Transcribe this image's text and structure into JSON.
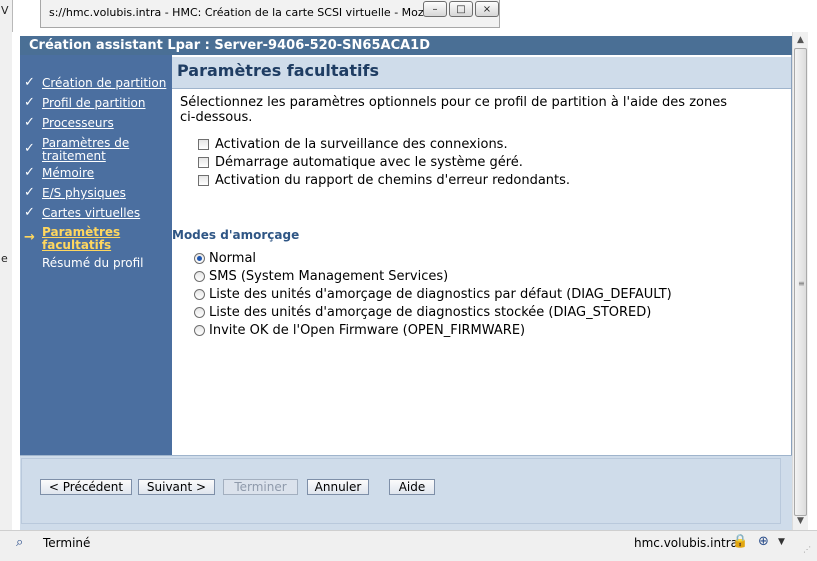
{
  "background_window": {
    "title": "s://hmc.volubis.intra - HMC: Création de la carte SCSI virtuelle - Moz...",
    "controls": [
      "–",
      "□",
      "×"
    ],
    "edge_letters": [
      "V",
      "e"
    ]
  },
  "dialog": {
    "title": "Création assistant Lpar : Server-9406-520-SN65ACA1D",
    "check_glyph": "✓",
    "arrow_glyph": "→",
    "nav": [
      {
        "label": "Création de partition",
        "state": "done"
      },
      {
        "label": "Profil de partition",
        "state": "done"
      },
      {
        "label": "Processeurs",
        "state": "done"
      },
      {
        "label": "Paramètres de traitement",
        "line1": "Paramètres de",
        "line2": "traitement",
        "state": "done"
      },
      {
        "label": "Mémoire",
        "state": "done"
      },
      {
        "label": "E/S physiques",
        "state": "done"
      },
      {
        "label": "Cartes virtuelles",
        "state": "done"
      },
      {
        "label": "Paramètres facultatifs",
        "line1": "Paramètres",
        "line2": "facultatifs",
        "state": "current"
      },
      {
        "label": "Résumé du profil",
        "state": "pending"
      }
    ],
    "section_title": "Paramètres facultatifs",
    "intro": "Sélectionnez les paramètres optionnels pour ce profil de partition à l'aide des zones ci-dessous.",
    "options": [
      {
        "label": "Activation de la surveillance des connexions.",
        "checked": false
      },
      {
        "label": "Démarrage automatique avec le système géré.",
        "checked": false
      },
      {
        "label": "Activation du rapport de chemins d'erreur redondants.",
        "checked": false
      }
    ],
    "boot_heading": "Modes d'amorçage",
    "boot_modes": [
      {
        "label": "Normal",
        "selected": true
      },
      {
        "label": "SMS (System Management Services)",
        "selected": false
      },
      {
        "label": "Liste des unités d'amorçage de diagnostics par défaut (DIAG_DEFAULT)",
        "selected": false
      },
      {
        "label": "Liste des unités d'amorçage de diagnostics stockée (DIAG_STORED)",
        "selected": false
      },
      {
        "label": "Invite OK de l'Open Firmware (OPEN_FIRMWARE)",
        "selected": false
      }
    ],
    "buttons": {
      "previous": "< Précédent",
      "next": "Suivant >",
      "finish": "Terminer",
      "cancel": "Annuler",
      "help": "Aide"
    }
  },
  "scrollbar": {
    "up": "▲",
    "down": "▼",
    "grip": "≡"
  },
  "statusbar": {
    "search_glyph": "⌕",
    "status": "Terminé",
    "host": "hmc.volubis.intra",
    "lock_glyph": "🔒",
    "zoom_glyph": "⊕",
    "dropdown_glyph": "▼",
    "grip": "⋰"
  },
  "colors": {
    "title_bar": "#4a6f95",
    "nav_bg": "#4b6fa0",
    "nav_current": "#ffd75e",
    "section_bg": "#cfdcea",
    "radio_dot": "#1e56b0"
  }
}
